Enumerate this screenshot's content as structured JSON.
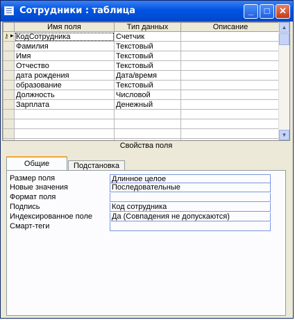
{
  "window": {
    "title": "Сотрудники : таблица"
  },
  "grid": {
    "headers": [
      "Имя поля",
      "Тип данных",
      "Описание"
    ],
    "rows": [
      [
        "КодСотрудника",
        "Счетчик",
        ""
      ],
      [
        "Фамилия",
        "Текстовый",
        ""
      ],
      [
        "Имя",
        "Текстовый",
        ""
      ],
      [
        "Отчество",
        "Текстовый",
        ""
      ],
      [
        "дата рождения",
        "Дата/время",
        ""
      ],
      [
        "образование",
        "Текстовый",
        ""
      ],
      [
        "Должность",
        "Числовой",
        ""
      ],
      [
        "Зарплата",
        "Денежный",
        ""
      ],
      [
        "",
        "",
        ""
      ],
      [
        "",
        "",
        ""
      ],
      [
        "",
        "",
        ""
      ],
      [
        "",
        "",
        ""
      ]
    ]
  },
  "properties_label": "Свойства поля",
  "tabs": [
    "Общие",
    "Подстановка"
  ],
  "props": [
    {
      "label": "Размер поля",
      "value": "Длинное целое"
    },
    {
      "label": "Новые значения",
      "value": "Последовательные"
    },
    {
      "label": "Формат поля",
      "value": ""
    },
    {
      "label": "Подпись",
      "value": "Код сотрудника"
    },
    {
      "label": "Индексированное поле",
      "value": "Да (Совпадения не допускаются)"
    },
    {
      "label": "Смарт-теги",
      "value": ""
    }
  ]
}
